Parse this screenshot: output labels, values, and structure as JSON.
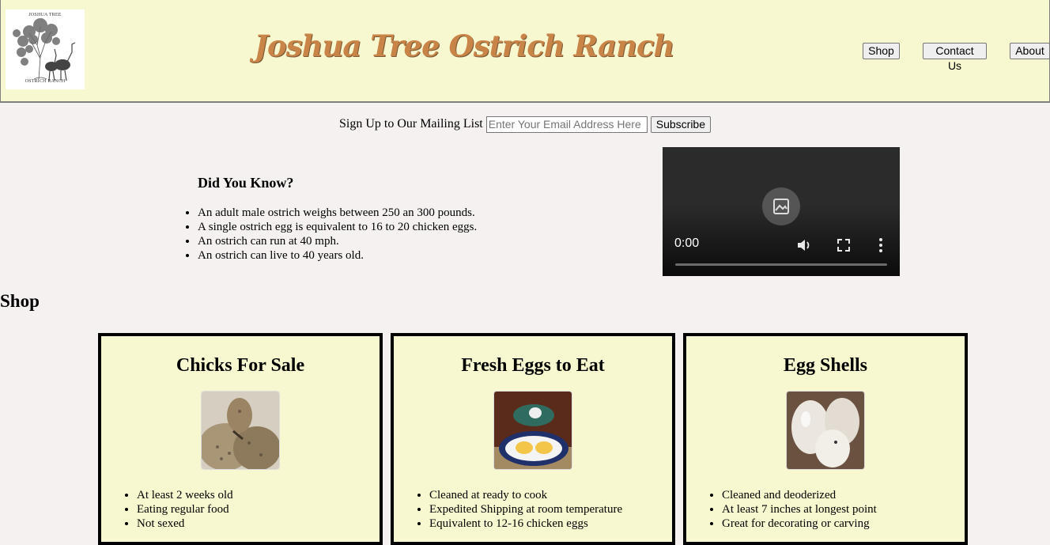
{
  "header": {
    "logo": {
      "top_text": "JOSHUA TREE",
      "bottom_text": "OSTRICH RANCH"
    },
    "title": "Joshua Tree Ostrich Ranch",
    "nav": [
      {
        "label": "Shop"
      },
      {
        "label": "Contact Us"
      },
      {
        "label": "About"
      }
    ]
  },
  "mailing": {
    "label": "Sign Up to Our Mailing List",
    "placeholder": "Enter Your Email Address Here",
    "button": "Subscribe"
  },
  "facts": {
    "heading": "Did You Know?",
    "items": [
      "An adult male ostrich weighs between 250 an 300 pounds.",
      "A single ostrich egg is equivalent to 16 to 20 chicken eggs.",
      "An ostrich can run at 40 mph.",
      "An ostrich can live to 40 years old."
    ]
  },
  "video": {
    "time": "0:00"
  },
  "shop": {
    "heading": "Shop",
    "cards": [
      {
        "title": "Chicks For Sale",
        "image": "ostrich-chicks-photo",
        "features": [
          "At least 2 weeks old",
          "Eating regular food",
          "Not sexed"
        ]
      },
      {
        "title": "Fresh Eggs to Eat",
        "image": "cooked-eggs-plate-photo",
        "features": [
          "Cleaned at ready to cook",
          "Expedited Shipping at room temperature",
          "Equivalent to 12-16 chicken eggs"
        ]
      },
      {
        "title": "Egg Shells",
        "image": "egg-shells-photo",
        "features": [
          "Cleaned and deoderized",
          "At least 7 inches at longest point",
          "Great for decorating or carving"
        ]
      }
    ]
  },
  "colors": {
    "header_bg": "#f8f8d0",
    "page_bg": "#f5f1f1",
    "title": "#c98447",
    "card_border": "#000000"
  }
}
